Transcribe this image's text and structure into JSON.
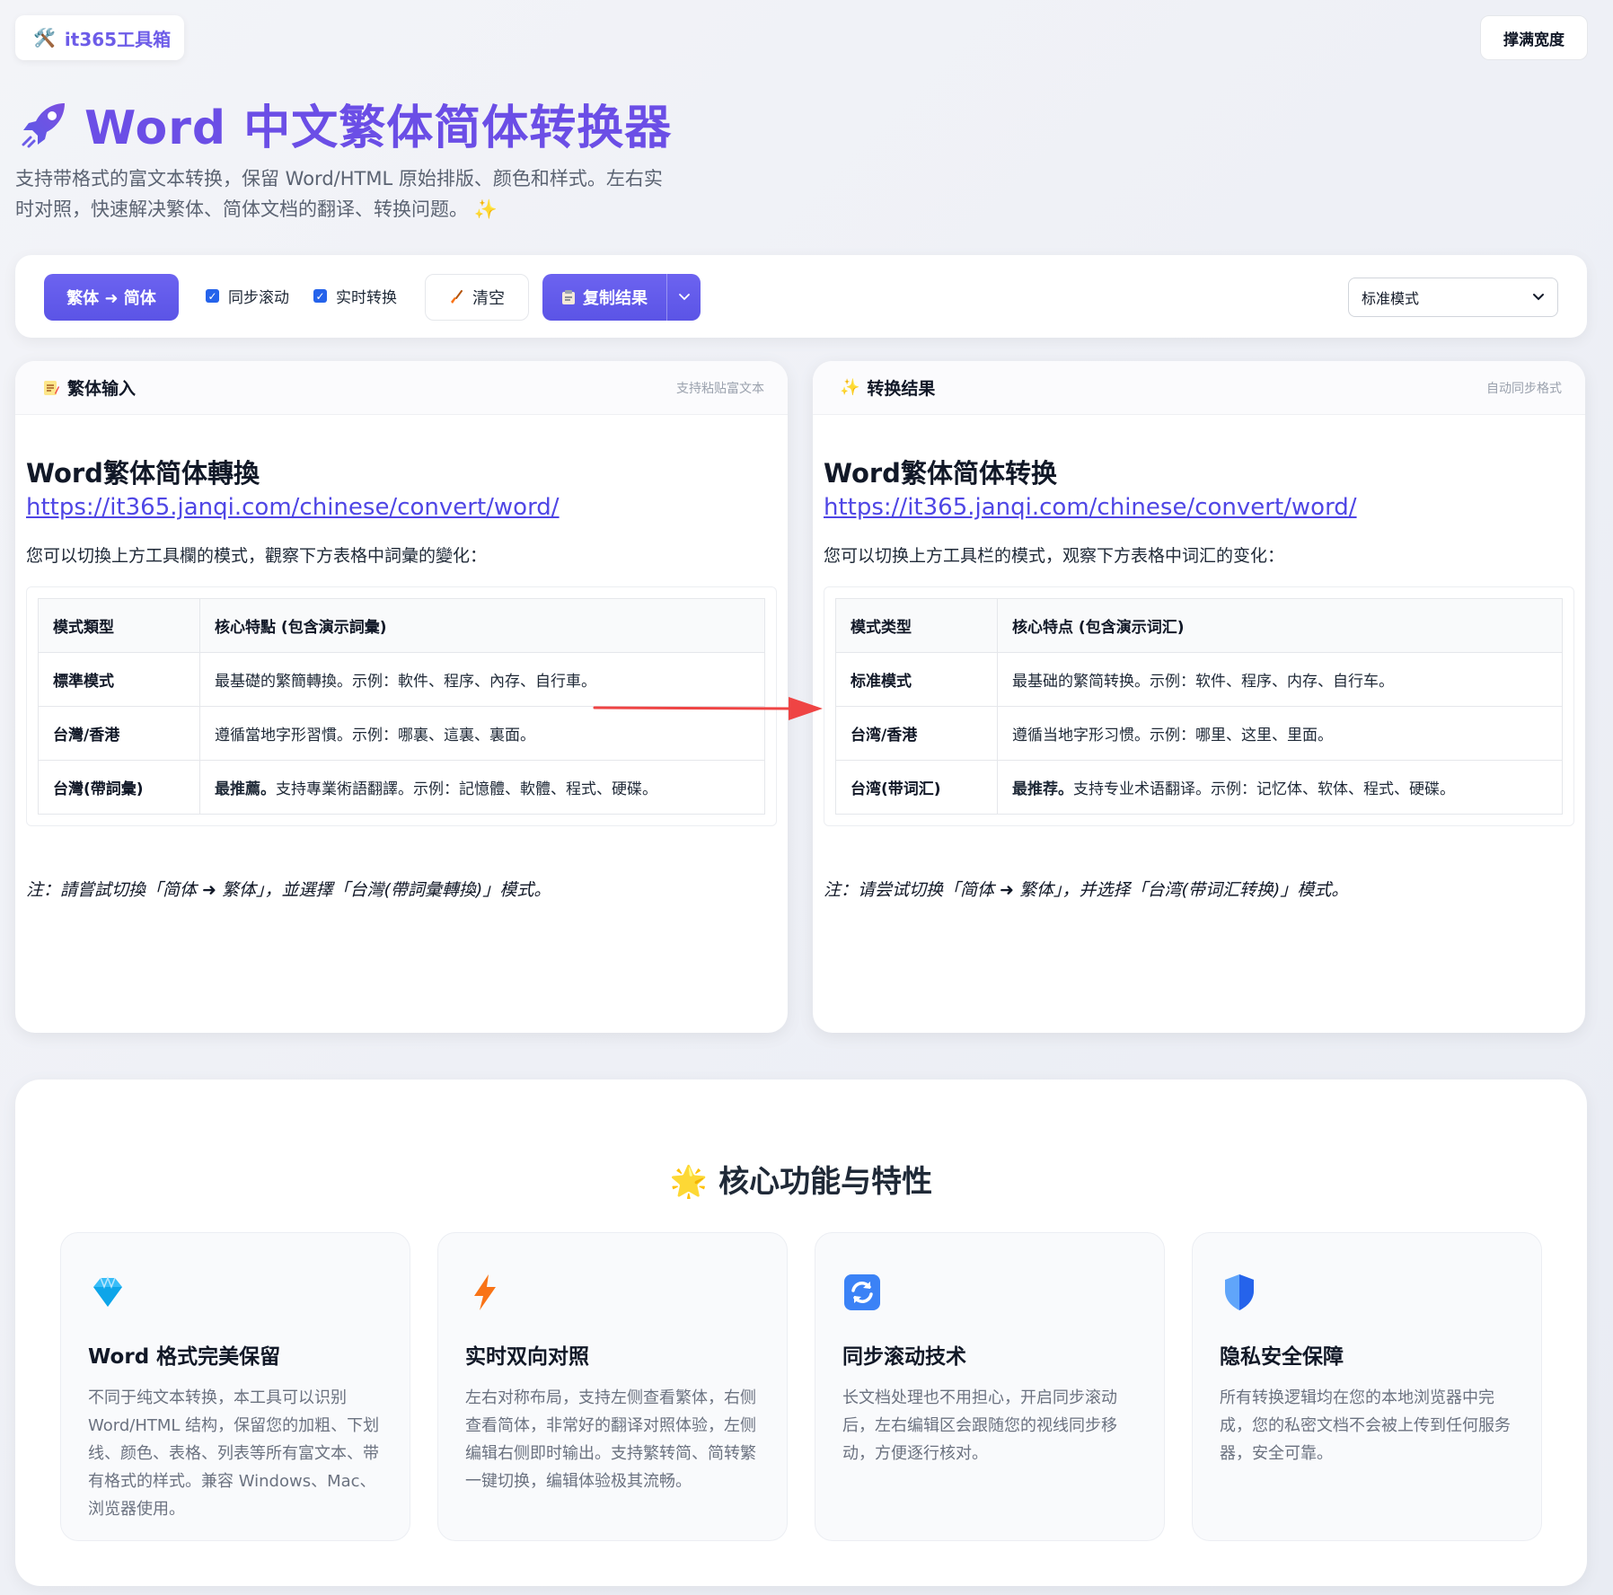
{
  "header": {
    "brand_icon": "🛠️",
    "brand": "it365工具箱",
    "fullwidth_button": "撑满宽度"
  },
  "hero": {
    "title": "Word 中文繁体简体转换器",
    "desc_line1": "支持带格式的富文本转换，保留 Word/HTML 原始排版、颜色和样式。左右实",
    "desc_line2": "时对照，快速解决繁体、简体文档的翻译、转换问题。 ✨"
  },
  "toolbar": {
    "direction_button": "繁体 ➜ 简体",
    "sync_scroll_label": "同步滚动",
    "sync_scroll_checked": true,
    "realtime_label": "实时转换",
    "realtime_checked": true,
    "clear_button": "清空",
    "copy_button": "复制结果",
    "mode_selected": "标准模式"
  },
  "left_panel": {
    "title": "繁体输入",
    "hint": "支持粘贴富文本",
    "doc_title": "Word繁体简体轉換",
    "doc_link": "https://it365.janqi.com/chinese/convert/word/",
    "lead": "您可以切換上方工具欄的模式，觀察下方表格中詞彙的變化：",
    "table": {
      "headers": [
        "模式類型",
        "核心特點 (包含演示詞彙)"
      ],
      "rows": [
        {
          "k": "標準模式",
          "strong": "",
          "v": "最基礎的繁簡轉換。示例：軟件、程序、內存、自行車。"
        },
        {
          "k": "台灣/香港",
          "strong": "",
          "v": "遵循當地字形習慣。示例：哪裏、這裏、裏面。"
        },
        {
          "k": "台灣(帶詞彙)",
          "strong": "最推薦。",
          "v": "支持專業術語翻譯。示例：記憶體、軟體、程式、硬碟。"
        }
      ]
    },
    "note": "注：請嘗試切換「简体 ➜ 繁体」，並選擇「台灣(帶詞彙轉換)」模式。"
  },
  "right_panel": {
    "title": "转换结果",
    "hint": "自动同步格式",
    "doc_title": "Word繁体简体转换",
    "doc_link": "https://it365.janqi.com/chinese/convert/word/",
    "lead": "您可以切换上方工具栏的模式，观察下方表格中词汇的变化：",
    "table": {
      "headers": [
        "模式类型",
        "核心特点 (包含演示词汇)"
      ],
      "rows": [
        {
          "k": "标准模式",
          "strong": "",
          "v": "最基础的繁简转换。示例：软件、程序、内存、自行车。"
        },
        {
          "k": "台湾/香港",
          "strong": "",
          "v": "遵循当地字形习惯。示例：哪里、这里、里面。"
        },
        {
          "k": "台湾(带词汇)",
          "strong": "最推荐。",
          "v": "支持专业术语翻译。示例：记忆体、软体、程式、硬碟。"
        }
      ]
    },
    "note": "注：请尝试切换「简体 ➜ 繁体」，并选择「台湾(带词汇转换)」模式。"
  },
  "features": {
    "title": "核心功能与特性",
    "cards": [
      {
        "icon": "diamond-icon",
        "title": "Word 格式完美保留",
        "desc": "不同于纯文本转换，本工具可以识别 Word/HTML 结构，保留您的加粗、下划线、颜色、表格、列表等所有富文本、带有格式的样式。兼容 Windows、Mac、浏览器使用。"
      },
      {
        "icon": "lightning-icon",
        "title": "实时双向对照",
        "desc": "左右对称布局，支持左侧查看繁体，右侧查看简体，非常好的翻译对照体验，左侧编辑右侧即时输出。支持繁转简、简转繁一键切换，编辑体验极其流畅。"
      },
      {
        "icon": "sync-icon",
        "title": "同步滚动技术",
        "desc": "长文档处理也不用担心，开启同步滚动后，左右编辑区会跟随您的视线同步移动，方便逐行核对。"
      },
      {
        "icon": "shield-icon",
        "title": "隐私安全保障",
        "desc": "所有转换逻辑均在您的本地浏览器中完成，您的私密文档不会被上传到任何服务器，安全可靠。"
      }
    ]
  },
  "colors": {
    "accent": "#6b4ee6",
    "primary_button": "#5b54e6",
    "arrow": "#ef4444"
  }
}
